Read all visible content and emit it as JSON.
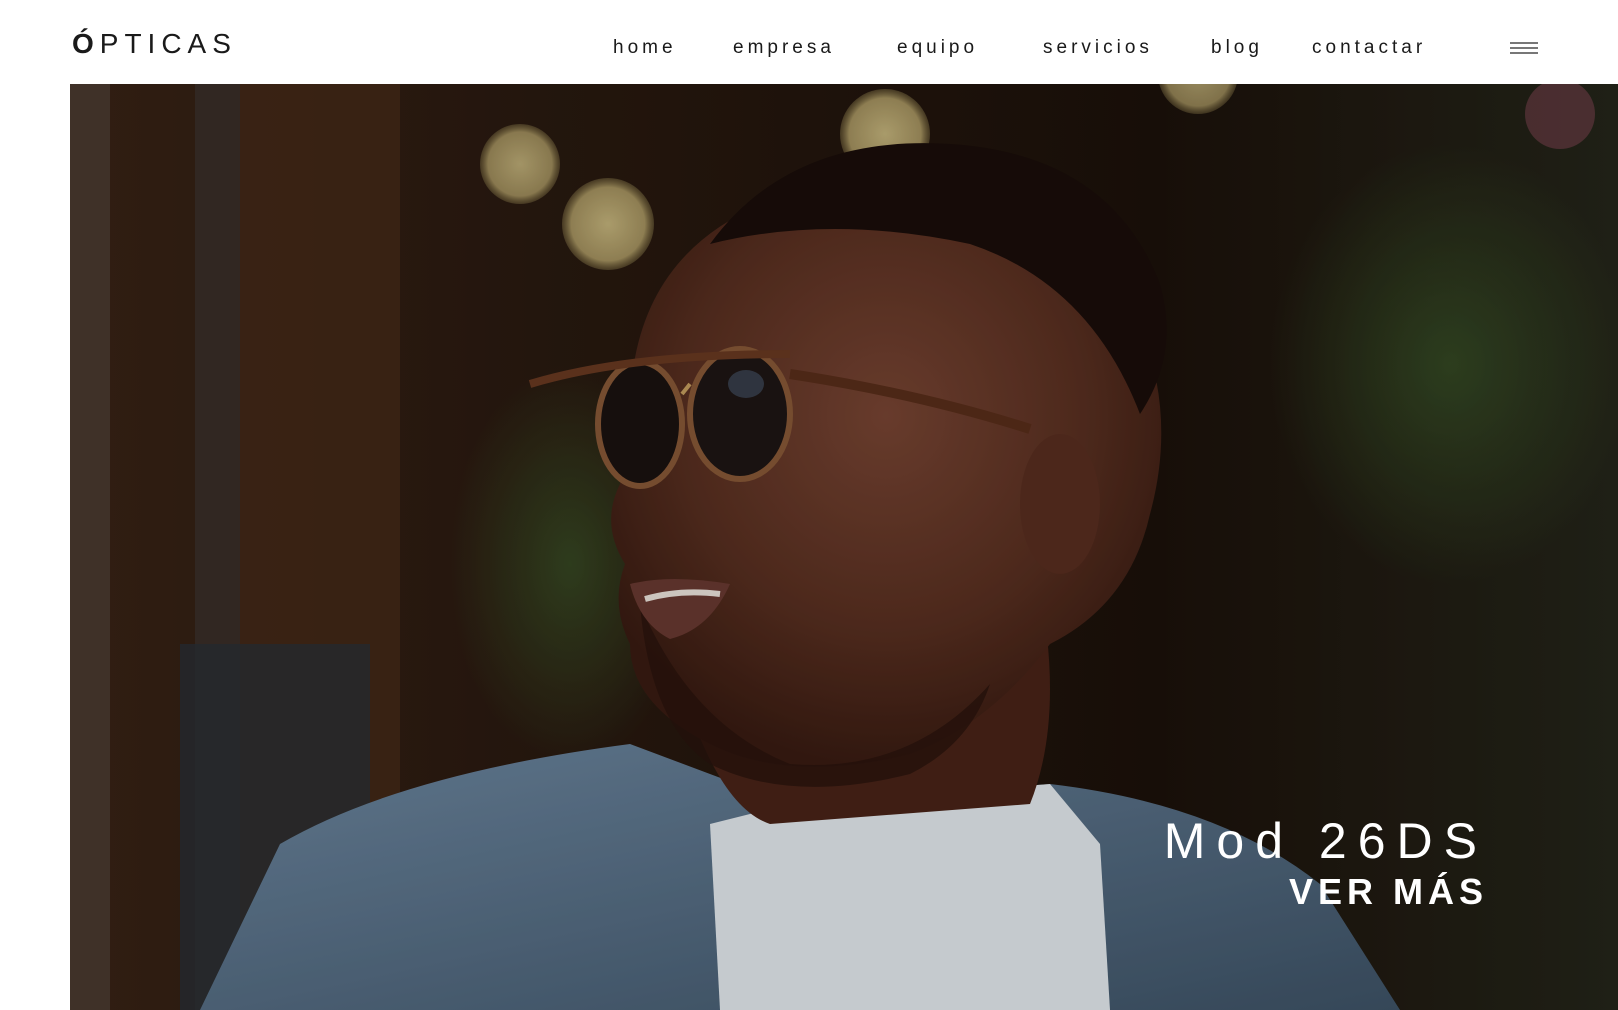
{
  "header": {
    "logo": {
      "first_letter": "Ó",
      "rest": "PTICAS"
    },
    "nav": [
      {
        "label": "home"
      },
      {
        "label": "empresa"
      },
      {
        "label": "equipo"
      },
      {
        "label": "servicios"
      },
      {
        "label": "blog"
      },
      {
        "label": "contactar"
      }
    ],
    "menu_icon": "hamburger-icon"
  },
  "hero": {
    "image": "man-with-sunglasses-photo",
    "title": "Mod 26DS",
    "cta": "VER MÁS"
  },
  "colors": {
    "text": "#1a1a1a",
    "hero_text": "#ffffff",
    "background": "#ffffff"
  }
}
